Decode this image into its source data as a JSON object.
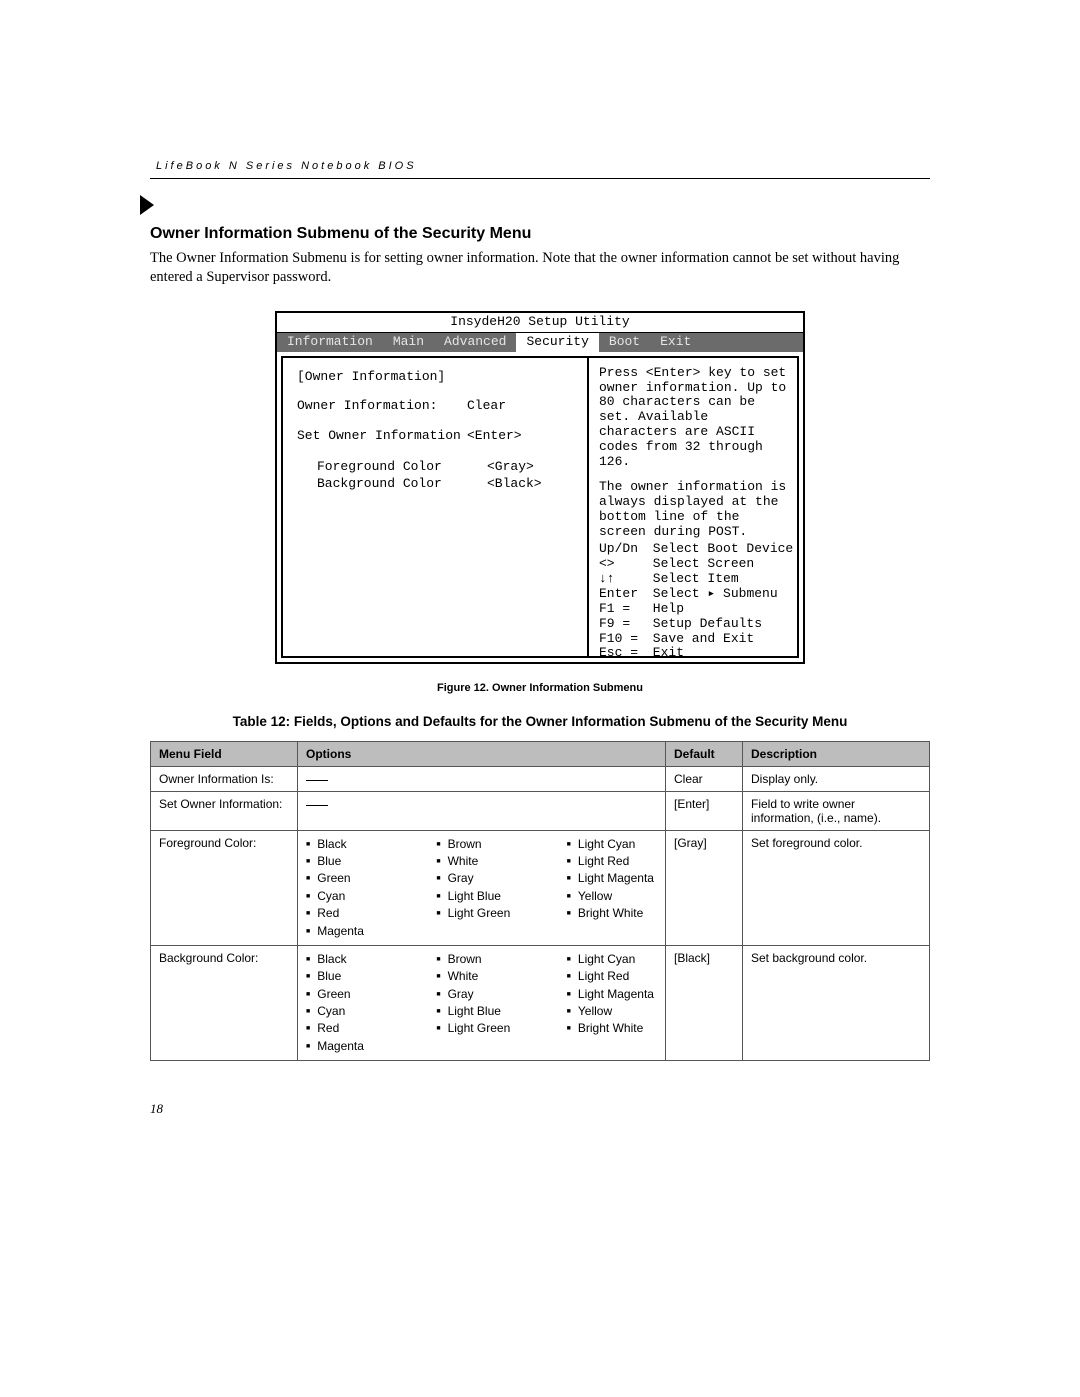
{
  "header": {
    "running": "LifeBook N Series Notebook BIOS"
  },
  "section": {
    "title": "Owner Information Submenu of the Security Menu",
    "intro": "The Owner Information Submenu is for setting owner information. Note that the owner information cannot be set without having entered a Supervisor password."
  },
  "bios": {
    "title": "InsydeH20 Setup Utility",
    "tabs": [
      "Information",
      "Main",
      "Advanced",
      "Security",
      "Boot",
      "Exit"
    ],
    "active_tab": "Security",
    "submenu_header": "[Owner Information]",
    "rows": [
      {
        "label": "Owner Information:",
        "value": "Clear"
      },
      {
        "label": "Set Owner Information",
        "value": "<Enter>"
      },
      {
        "label": "Foreground Color",
        "value": "<Gray>",
        "indent": true
      },
      {
        "label": "Background Color",
        "value": "<Black>",
        "indent": true
      }
    ],
    "help_para1": "Press <Enter> key to set owner information. Up to 80 characters can be set. Available characters are ASCII codes from 32 through 126.",
    "help_para2": "The owner information is always displayed at the bottom line of the screen during POST.",
    "help_lines": [
      {
        "key": "Up/Dn",
        "text": "Select Boot Device"
      },
      {
        "key": "<>",
        "text": "Select Screen"
      },
      {
        "key": "↓↑",
        "text": "Select Item"
      },
      {
        "key": "Enter",
        "text": "Select ▸ Submenu"
      },
      {
        "key": "F1  =",
        "text": "Help"
      },
      {
        "key": "F9  =",
        "text": "Setup Defaults"
      },
      {
        "key": "F10 =",
        "text": "Save and Exit"
      },
      {
        "key": "Esc =",
        "text": "Exit"
      }
    ]
  },
  "figure_caption": "Figure 12.  Owner Information Submenu",
  "table_title": "Table 12: Fields, Options and Defaults for the Owner Information Submenu of the Security Menu",
  "table": {
    "headers": [
      "Menu Field",
      "Options",
      "Default",
      "Description"
    ],
    "rows": [
      {
        "field": "Owner Information Is:",
        "options_type": "dash",
        "default": "Clear",
        "desc": "Display only."
      },
      {
        "field": "Set Owner Information:",
        "options_type": "dash",
        "default": "[Enter]",
        "desc": "Field to write owner information, (i.e., name)."
      },
      {
        "field": "Foreground Color:",
        "options_type": "colors",
        "options": [
          [
            "Black",
            "Blue",
            "Green",
            "Cyan",
            "Red",
            "Magenta"
          ],
          [
            "Brown",
            "White",
            "Gray",
            "Light Blue",
            "Light Green"
          ],
          [
            "Light Cyan",
            "Light Red",
            "Light Magenta",
            "Yellow",
            "Bright White"
          ]
        ],
        "default": "[Gray]",
        "desc": "Set foreground color."
      },
      {
        "field": "Background Color:",
        "options_type": "colors",
        "options": [
          [
            "Black",
            "Blue",
            "Green",
            "Cyan",
            "Red",
            "Magenta"
          ],
          [
            "Brown",
            "White",
            "Gray",
            "Light Blue",
            "Light Green"
          ],
          [
            "Light Cyan",
            "Light Red",
            "Light Magenta",
            "Yellow",
            "Bright White"
          ]
        ],
        "default": "[Black]",
        "desc": "Set background color."
      }
    ]
  },
  "page_number": "18"
}
